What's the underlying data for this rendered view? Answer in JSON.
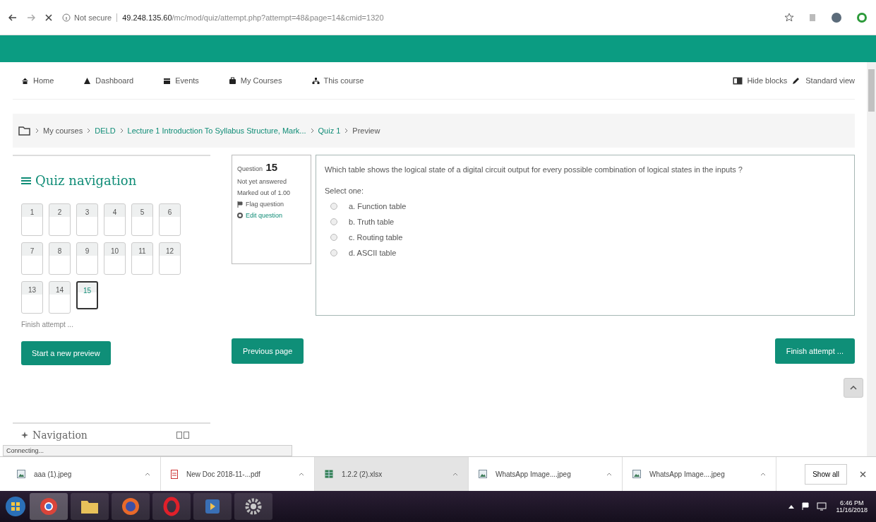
{
  "browser": {
    "security": "Not secure",
    "host": "49.248.135.60",
    "path": "/mc/mod/quiz/attempt.php?attempt=48&page=14&cmid=1320"
  },
  "nav": {
    "items": [
      {
        "label": "Home"
      },
      {
        "label": "Dashboard"
      },
      {
        "label": "Events"
      },
      {
        "label": "My Courses"
      },
      {
        "label": "This course"
      }
    ],
    "right": [
      {
        "label": "Hide blocks"
      },
      {
        "label": "Standard view"
      }
    ]
  },
  "breadcrumb": [
    {
      "label": "My courses",
      "link": false
    },
    {
      "label": "DELD",
      "link": true
    },
    {
      "label": "Lecture 1 Introduction To Syllabus Structure, Mark...",
      "link": true
    },
    {
      "label": "Quiz 1",
      "link": true
    },
    {
      "label": "Preview",
      "link": false
    }
  ],
  "quiz_nav": {
    "title": "Quiz navigation",
    "buttons": [
      {
        "label": "1",
        "selected": false
      },
      {
        "label": "2",
        "selected": false
      },
      {
        "label": "3",
        "selected": false
      },
      {
        "label": "4",
        "selected": false
      },
      {
        "label": "5",
        "selected": false
      },
      {
        "label": "6",
        "selected": false
      },
      {
        "label": "7",
        "selected": false
      },
      {
        "label": "8",
        "selected": false
      },
      {
        "label": "9",
        "selected": false
      },
      {
        "label": "10",
        "selected": false
      },
      {
        "label": "11",
        "selected": false
      },
      {
        "label": "12",
        "selected": false
      },
      {
        "label": "13",
        "selected": false
      },
      {
        "label": "14",
        "selected": false
      },
      {
        "label": "15",
        "selected": true
      }
    ],
    "finish_link": "Finish attempt ...",
    "start_button": "Start a new preview"
  },
  "question_info": {
    "label": "Question",
    "number": "15",
    "status": "Not yet answered",
    "marked": "Marked out of 1.00",
    "flag": "Flag question",
    "edit": "Edit question"
  },
  "question": {
    "text": "Which table shows the logical state of a digital circuit output for every possible combination of logical states in the inputs ?",
    "prompt": "Select one:",
    "options": [
      {
        "label": "a. Function table",
        "selected": false
      },
      {
        "label": "b. Truth table",
        "selected": false
      },
      {
        "label": "c. Routing table",
        "selected": false
      },
      {
        "label": "d. ASCII table",
        "selected": false
      }
    ]
  },
  "previous_button": "Previous page",
  "finish_button": "Finish attempt ...",
  "next_block_title": "Navigation",
  "status_text": "Connecting...",
  "downloads": [
    {
      "name": "aaa (1).jpeg",
      "kind": "image"
    },
    {
      "name": "New Doc 2018-11-...pdf",
      "kind": "pdf"
    },
    {
      "name": "1.2.2 (2).xlsx",
      "kind": "sheet"
    },
    {
      "name": "WhatsApp Image....jpeg",
      "kind": "image"
    },
    {
      "name": "WhatsApp Image....jpeg",
      "kind": "image"
    }
  ],
  "show_all": "Show all",
  "clock": {
    "time": "6:46 PM",
    "date": "11/16/2018"
  }
}
